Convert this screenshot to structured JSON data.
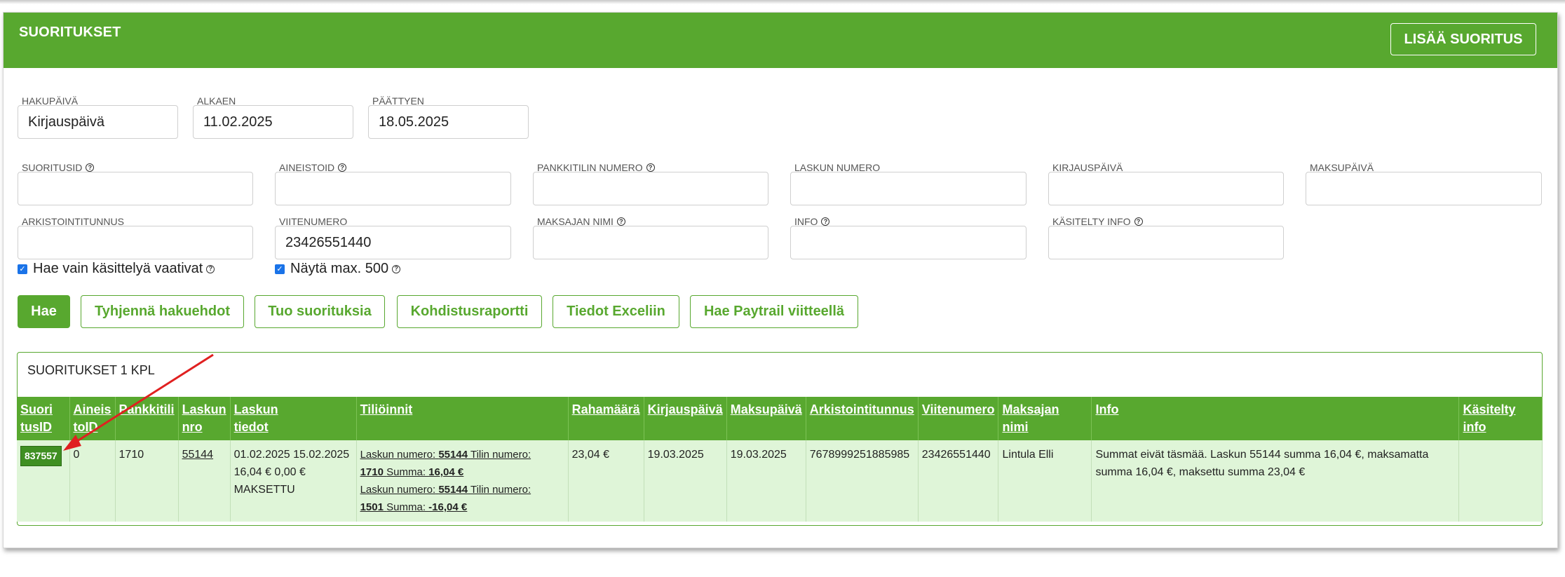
{
  "header": {
    "title": "SUORITUKSET",
    "add_button": "LISÄÄ SUORITUS"
  },
  "filters": {
    "hakupaiva": {
      "label": "HAKUPÄIVÄ",
      "value": "Kirjauspäivä"
    },
    "alkaen": {
      "label": "ALKAEN",
      "value": "11.02.2025"
    },
    "paattyen": {
      "label": "PÄÄTTYEN",
      "value": "18.05.2025"
    },
    "suoritusid": {
      "label": "SUORITUSID",
      "value": ""
    },
    "aineistoid": {
      "label": "AINEISTOID",
      "value": ""
    },
    "pankkitili": {
      "label": "PANKKITILIN NUMERO",
      "value": ""
    },
    "laskun_numero": {
      "label": "LASKUN NUMERO",
      "value": ""
    },
    "kirjauspaiva": {
      "label": "KIRJAUSPÄIVÄ",
      "value": ""
    },
    "maksupaiva": {
      "label": "MAKSUPÄIVÄ",
      "value": ""
    },
    "arkistointitunnus": {
      "label": "ARKISTOINTITUNNUS",
      "value": ""
    },
    "viitenumero": {
      "label": "VIITENUMERO",
      "value": "23426551440"
    },
    "maksajan_nimi": {
      "label": "MAKSAJAN NIMI",
      "value": ""
    },
    "info": {
      "label": "INFO",
      "value": ""
    },
    "kasitelty_info": {
      "label": "KÄSITELTY INFO",
      "value": ""
    },
    "check_kasittely": {
      "label": "Hae vain käsittelyä vaativat",
      "checked": true
    },
    "check_max": {
      "label": "Näytä max. 500",
      "checked": true
    }
  },
  "buttons": {
    "hae": "Hae",
    "tyhjenna": "Tyhjennä hakuehdot",
    "tuo": "Tuo suorituksia",
    "kohdistus": "Kohdistusraportti",
    "excel": "Tiedot Exceliin",
    "paytrail": "Hae Paytrail viitteellä"
  },
  "results": {
    "title": "SUORITUKSET 1 KPL",
    "columns": {
      "suoritusid": [
        "Suori",
        "tusID"
      ],
      "aineistoid": [
        "Aineis",
        "toID"
      ],
      "pankkitili": "Pankkitili",
      "laskun_nro": [
        "Laskun",
        "nro"
      ],
      "laskun_tiedot": [
        "Laskun",
        "tiedot"
      ],
      "tilioinnit": "Tiliöinnit",
      "rahamaara": "Rahamäärä",
      "kirjauspaiva": "Kirjauspäivä",
      "maksupaiva": "Maksupäivä",
      "arkistointitunnus": "Arkistointitunnus",
      "viitenumero": "Viitenumero",
      "maksajan_nimi": "Maksajan nimi",
      "info": "Info",
      "kasitelty_info": "Käsitelty info"
    },
    "row": {
      "suoritusid": "837557",
      "aineistoid": "0",
      "pankkitili": "1710",
      "laskun_nro": "55144",
      "laskun_tiedot": [
        "01.02.2025 15.02.2025",
        "16,04 € 0,00 €",
        "MAKSETTU"
      ],
      "tilioinnit": [
        {
          "laskun_label": "Laskun numero:",
          "laskun": "55144",
          "tili_label": "Tilin numero:",
          "tili": "1710",
          "summa_label": "Summa:",
          "summa": "16,04 €"
        },
        {
          "laskun_label": "Laskun numero:",
          "laskun": "55144",
          "tili_label": "Tilin numero:",
          "tili": "1501",
          "summa_label": "Summa:",
          "summa": "-16,04 €"
        }
      ],
      "rahamaara": "23,04 €",
      "kirjauspaiva": "19.03.2025",
      "maksupaiva": "19.03.2025",
      "arkistointitunnus": "7678999251885985",
      "viitenumero": "23426551440",
      "maksajan_nimi": "Lintula Elli",
      "info": "Summat eivät täsmää. Laskun 55144 summa 16,04 €, maksamatta summa 16,04 €, maksettu summa 23,04 €",
      "kasitelty_info": ""
    }
  },
  "colors": {
    "brand_green": "#58a82f",
    "row_bg": "#dff5d8",
    "arrow": "#e02020"
  },
  "icons": {
    "help": "question-circle-icon",
    "annotation": "red-arrow"
  }
}
